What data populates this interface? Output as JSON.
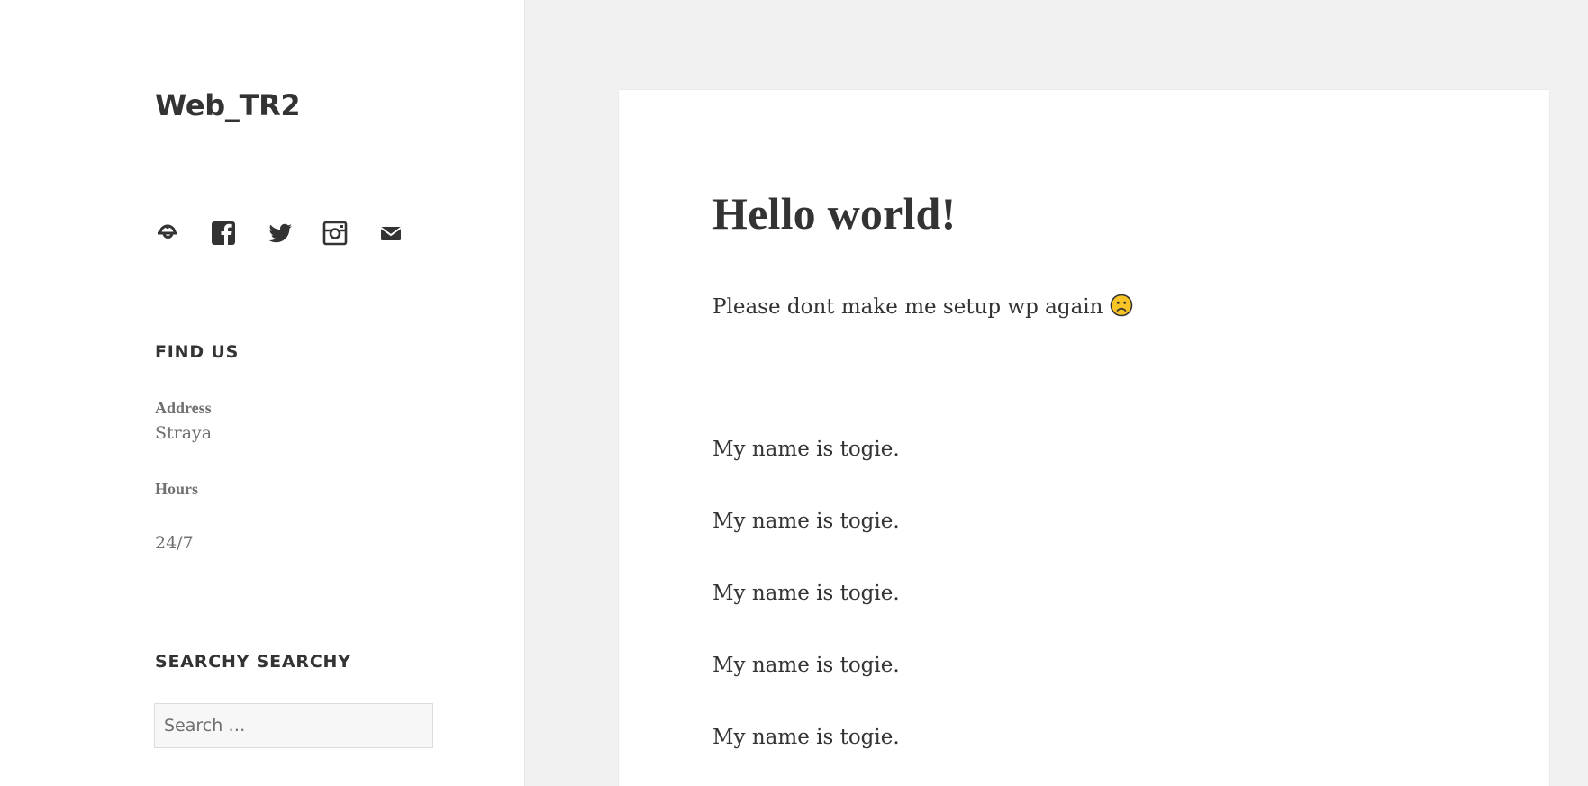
{
  "sidebar": {
    "site_title": "Web_TR2",
    "social_icons": [
      "dribbble-icon",
      "facebook-icon",
      "twitter-icon",
      "instagram-icon",
      "mail-icon"
    ],
    "find_us": {
      "title": "FIND US",
      "address_label": "Address",
      "address_value": "Straya",
      "hours_label": "Hours",
      "hours_value": "24/7"
    },
    "search_widget": {
      "title": "SEARCHY SEARCHY",
      "placeholder": "Search …"
    }
  },
  "article": {
    "title": "Hello world!",
    "intro": "Please dont make me setup wp again",
    "intro_emoji": "frowning-face-icon",
    "paragraphs": [
      "My name is togie.",
      "My name is togie.",
      "My name is togie.",
      "My name is togie.",
      "My name is togie."
    ]
  },
  "colors": {
    "page_background": "#f1f1f1",
    "panel_background": "#ffffff",
    "text": "#333333",
    "muted_text": "#707070",
    "emoji_yellow": "#f7c325"
  }
}
